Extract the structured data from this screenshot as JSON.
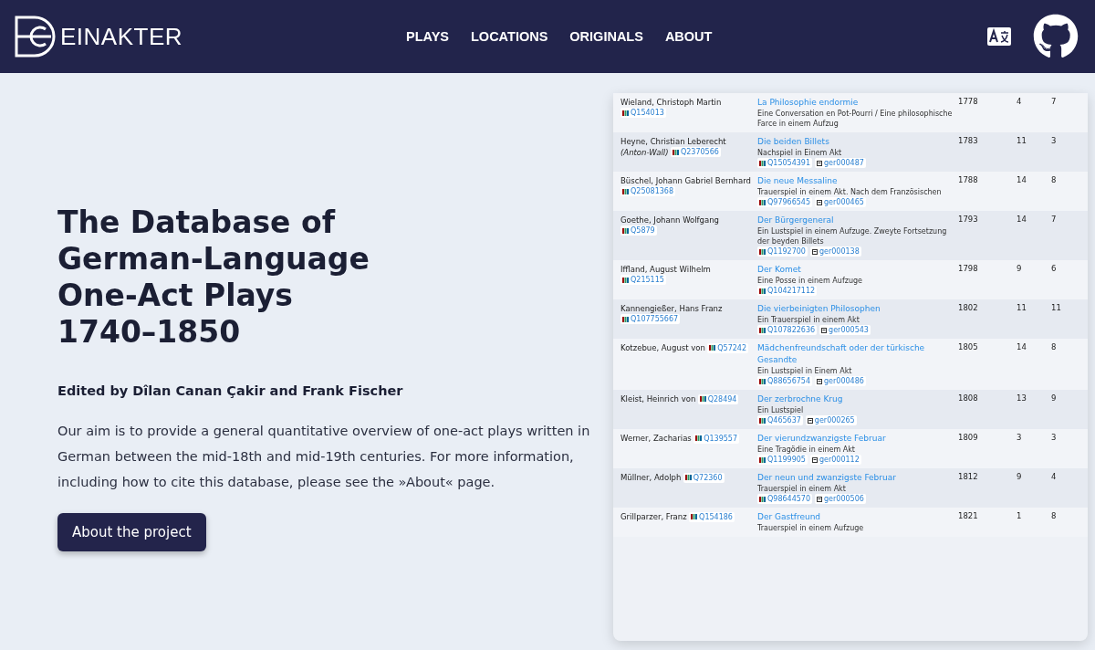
{
  "header": {
    "brand": "EINAKTER",
    "nav": [
      {
        "label": "PLAYS",
        "selected": false
      },
      {
        "label": "LOCATIONS",
        "selected": false
      },
      {
        "label": "ORIGINALS",
        "selected": false
      },
      {
        "label": "ABOUT",
        "selected": false
      }
    ]
  },
  "hero": {
    "title_lines": [
      "The Database of",
      "German-Language",
      "One-Act Plays",
      "1740–1850"
    ],
    "editors": "Edited by Dîlan Canan Çakir and Frank Fischer",
    "description": "Our aim is to provide a general quantitative overview of one-act plays written in German between the mid-18th and mid-19th centuries. For more information, including how to cite this database, please see the »About« page.",
    "button": "About the project"
  },
  "preview_table": {
    "rows": [
      {
        "author": "Wieland, Christoph Martin",
        "author_id": "Q154013",
        "title": "La Philosophie endormie",
        "subtitle": "Eine Conversation en Pot-Pourri / Eine philosophische Farce in einem Aufzug",
        "year": "1778",
        "column_4": "4",
        "column_5": "7"
      },
      {
        "author": "Heyne, Christian Leberecht",
        "pseudonym": "(Anton-Wall)",
        "author_id": "Q2370566",
        "title": "Die beiden Billets",
        "subtitle": "Nachspiel in Einem Akt",
        "play_ids": [
          "Q15054391",
          "ger000487"
        ],
        "year": "1783",
        "column_4": "11",
        "column_5": "3"
      },
      {
        "author": "Büschel, Johann Gabriel Bernhard",
        "author_id": "Q25081368",
        "title": "Die neue Messaline",
        "subtitle": "Trauerspiel in einem Akt. Nach dem Französischen",
        "play_ids": [
          "Q97966545",
          "ger000465"
        ],
        "year": "1788",
        "column_4": "14",
        "column_5": "8"
      },
      {
        "author": "Goethe, Johann Wolfgang",
        "author_id": "Q5879",
        "title": "Der Bürgergeneral",
        "subtitle": "Ein Lustspiel in einem Aufzuge. Zweyte Fortsetzung der beyden Billets",
        "play_ids": [
          "Q1192700",
          "ger000138"
        ],
        "year": "1793",
        "column_4": "14",
        "column_5": "7"
      },
      {
        "author": "Iffland, August Wilhelm",
        "author_id": "Q215115",
        "title": "Der Komet",
        "subtitle": "Eine Posse in einem Aufzuge",
        "play_ids": [
          "Q104217112"
        ],
        "year": "1798",
        "column_4": "9",
        "column_5": "6"
      },
      {
        "author": "Kannengießer, Hans Franz",
        "author_id": "Q107755667",
        "title": "Die vierbeinigten Philosophen",
        "subtitle": "Ein Trauerspiel in einem Akt",
        "play_ids": [
          "Q107822636",
          "ger000543"
        ],
        "year": "1802",
        "column_4": "11",
        "column_5": "11"
      },
      {
        "author": "Kotzebue, August von",
        "author_id": "Q57242",
        "title": "Mädchenfreundschaft oder der türkische Gesandte",
        "subtitle": "Ein Lustspiel in Einem Akt",
        "play_ids": [
          "Q88656754",
          "ger000486"
        ],
        "year": "1805",
        "column_4": "14",
        "column_5": "8"
      },
      {
        "author": "Kleist, Heinrich von",
        "author_id": "Q28494",
        "title": "Der zerbrochne Krug",
        "subtitle": "Ein Lustspiel",
        "play_ids": [
          "Q465637",
          "ger000265"
        ],
        "year": "1808",
        "column_4": "13",
        "column_5": "9"
      },
      {
        "author": "Werner, Zacharias",
        "author_id": "Q139557",
        "title": "Der vierundzwanzigste Februar",
        "subtitle": "Eine Tragödie in einem Akt",
        "play_ids": [
          "Q1199905",
          "ger000112"
        ],
        "year": "1809",
        "column_4": "3",
        "column_5": "3"
      },
      {
        "author": "Müllner, Adolph",
        "author_id": "Q72360",
        "title": "Der neun und zwanzigste Februar",
        "subtitle": "Trauerspiel in einem Akt",
        "play_ids": [
          "Q98644570",
          "ger000506"
        ],
        "year": "1812",
        "column_4": "9",
        "column_5": "4"
      },
      {
        "author": "Grillparzer, Franz",
        "author_id": "Q154186",
        "title": "Der Gastfreund",
        "subtitle": "Trauerspiel in einem Aufzuge",
        "year": "1821",
        "column_4": "1",
        "column_5": "8"
      }
    ]
  }
}
